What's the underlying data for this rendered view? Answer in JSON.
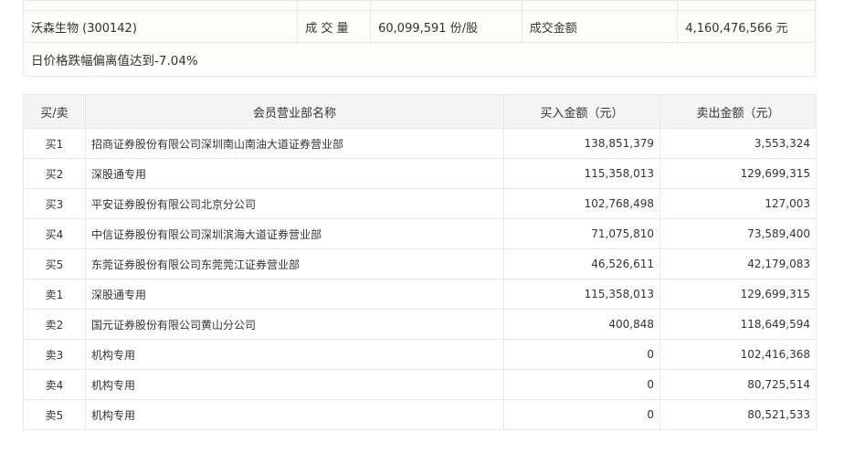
{
  "summary": {
    "stock": "沃森生物 (300142)",
    "volume_label": "成 交 量",
    "volume_value": "60,099,591 份/股",
    "amount_label": "成交金额",
    "amount_value": "4,160,476,566 元",
    "note": "日价格跌幅偏离值达到-7.04%"
  },
  "table": {
    "headers": [
      "买/卖",
      "会员营业部名称",
      "买入金额（元）",
      "卖出金额（元）"
    ],
    "rows": [
      {
        "side": "买1",
        "name": "招商证券股份有限公司深圳南山南油大道证券营业部",
        "buy": "138,851,379",
        "sell": "3,553,324"
      },
      {
        "side": "买2",
        "name": "深股通专用",
        "buy": "115,358,013",
        "sell": "129,699,315"
      },
      {
        "side": "买3",
        "name": "平安证券股份有限公司北京分公司",
        "buy": "102,768,498",
        "sell": "127,003"
      },
      {
        "side": "买4",
        "name": "中信证券股份有限公司深圳滨海大道证券营业部",
        "buy": "71,075,810",
        "sell": "73,589,400"
      },
      {
        "side": "买5",
        "name": "东莞证券股份有限公司东莞莞江证券营业部",
        "buy": "46,526,611",
        "sell": "42,179,083"
      },
      {
        "side": "卖1",
        "name": "深股通专用",
        "buy": "115,358,013",
        "sell": "129,699,315"
      },
      {
        "side": "卖2",
        "name": "国元证券股份有限公司黄山分公司",
        "buy": "400,848",
        "sell": "118,649,594"
      },
      {
        "side": "卖3",
        "name": "机构专用",
        "buy": "0",
        "sell": "102,416,368"
      },
      {
        "side": "卖4",
        "name": "机构专用",
        "buy": "0",
        "sell": "80,725,514"
      },
      {
        "side": "卖5",
        "name": "机构专用",
        "buy": "0",
        "sell": "80,521,533"
      }
    ]
  }
}
